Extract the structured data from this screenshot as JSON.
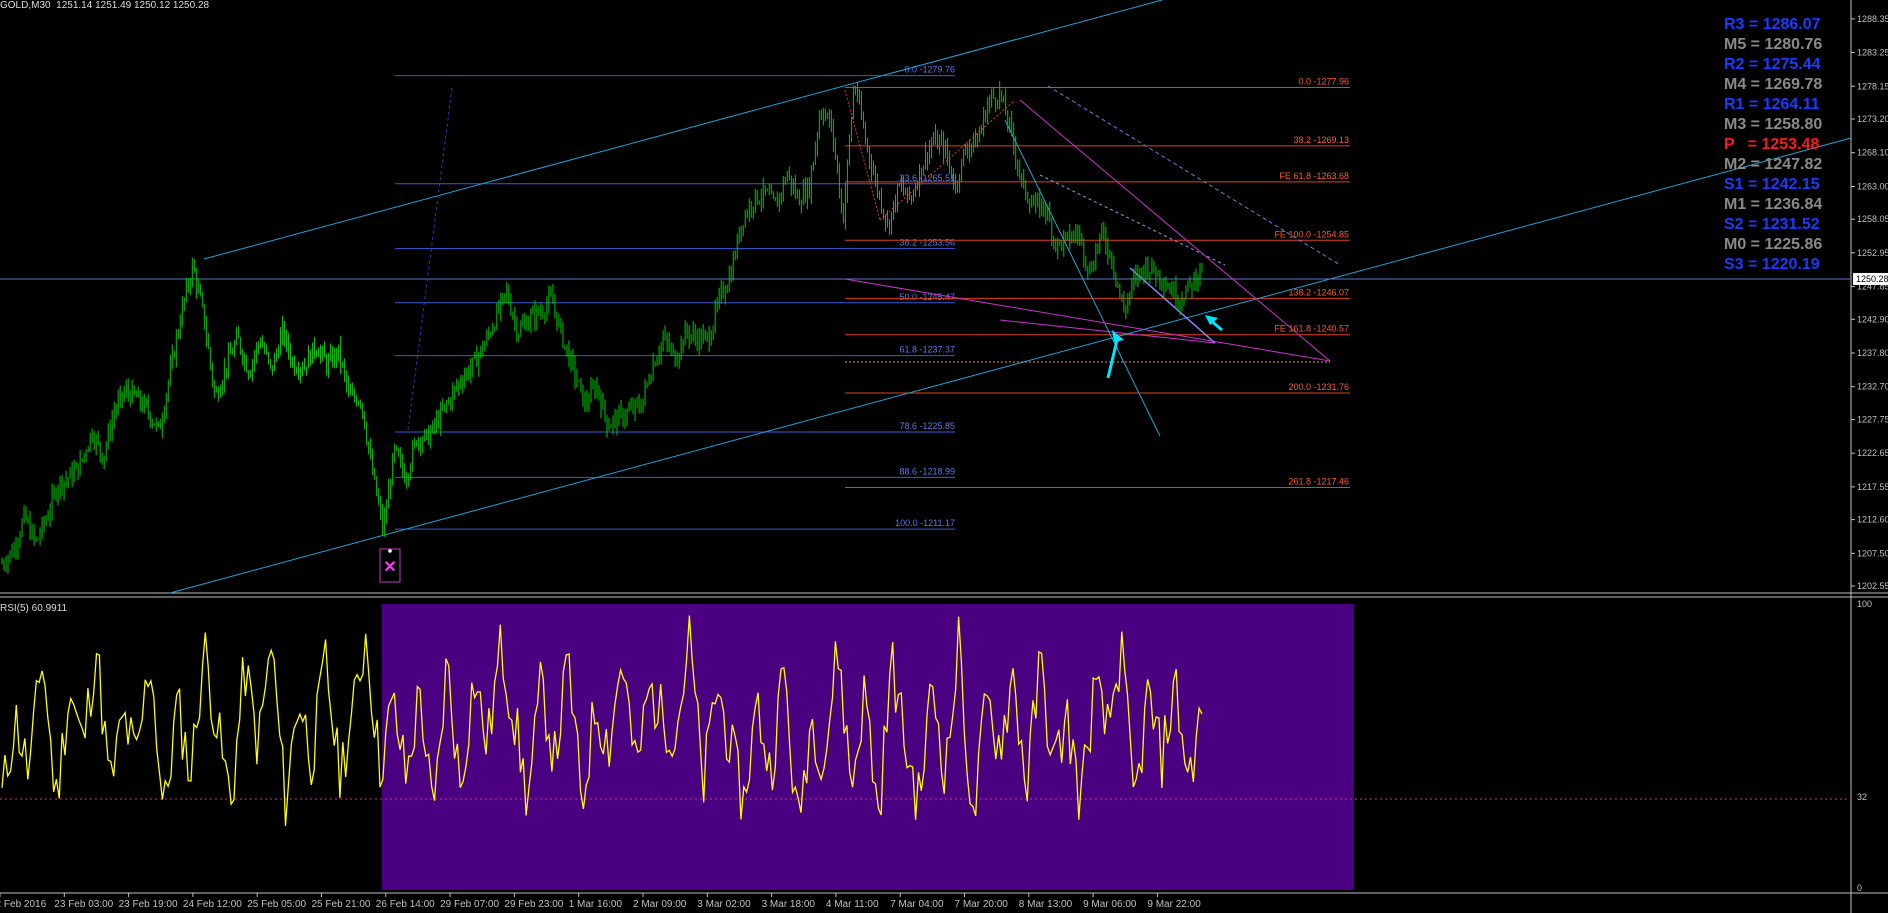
{
  "header": {
    "symbol": "GOLD,M30",
    "ohlc": "1251.14 1251.49 1250.12 1250.28",
    "current_price": "1250.28"
  },
  "rsi": {
    "label": "RSI(5) 60.9911",
    "levels": [
      "100",
      "32",
      "0"
    ]
  },
  "colors": {
    "background": "#000000",
    "candles": "#00c800",
    "channel": "#1fa5d8",
    "fib_retracement": "#3a5bd8",
    "fib_expansion": "#e0401a",
    "magenta": "#cc33cc",
    "rsi_line": "#ffff00",
    "rsi_zone": "#4b0082"
  },
  "pivots": [
    {
      "label": "R3 = 1286.07",
      "color": "#1a3cff"
    },
    {
      "label": "M5 = 1280.76",
      "color": "#8a8a8a"
    },
    {
      "label": "R2 = 1275.44",
      "color": "#1a3cff"
    },
    {
      "label": "M4 = 1269.78",
      "color": "#8a8a8a"
    },
    {
      "label": "R1 = 1264.11",
      "color": "#1a3cff"
    },
    {
      "label": "M3 = 1258.80",
      "color": "#8a8a8a"
    },
    {
      "label": "P   = 1253.48",
      "color": "#ff1a1a"
    },
    {
      "label": "M2 = 1247.82",
      "color": "#8a8a8a"
    },
    {
      "label": "S1 = 1242.15",
      "color": "#1a3cff"
    },
    {
      "label": "M1 = 1236.84",
      "color": "#8a8a8a"
    },
    {
      "label": "S2 = 1231.52",
      "color": "#1a3cff"
    },
    {
      "label": "M0 = 1225.86",
      "color": "#8a8a8a"
    },
    {
      "label": "S3 = 1220.19",
      "color": "#1a3cff"
    }
  ],
  "chart_data": {
    "type": "line",
    "title": "GOLD,M30",
    "ylim": [
      1201.5,
      1291.2
    ],
    "y_ticks": [
      "1288.35",
      "1283.25",
      "1278.15",
      "1273.20",
      "1268.10",
      "1263.00",
      "1258.05",
      "1252.95",
      "1247.85",
      "1242.90",
      "1237.80",
      "1232.70",
      "1227.75",
      "1222.65",
      "1217.55",
      "1212.60",
      "1207.50",
      "1202.55"
    ],
    "x_labels": [
      "22 Feb 2016",
      "23 Feb 03:00",
      "23 Feb 19:00",
      "24 Feb 12:00",
      "25 Feb 05:00",
      "25 Feb 21:00",
      "26 Feb 14:00",
      "29 Feb 07:00",
      "29 Feb 23:00",
      "1 Mar 16:00",
      "2 Mar 09:00",
      "3 Mar 02:00",
      "3 Mar 18:00",
      "4 Mar 11:00",
      "7 Mar 04:00",
      "7 Mar 20:00",
      "8 Mar 13:00",
      "9 Mar 06:00",
      "9 Mar 22:00"
    ],
    "close_path": [
      1206,
      1208,
      1213,
      1209,
      1213,
      1218,
      1219,
      1221,
      1226,
      1222,
      1229,
      1232,
      1231,
      1229,
      1226,
      1235,
      1244,
      1251,
      1243,
      1231,
      1236,
      1240,
      1235,
      1240,
      1235,
      1241,
      1236,
      1236,
      1239,
      1236,
      1238,
      1231,
      1231,
      1220,
      1211,
      1223,
      1219,
      1225,
      1225,
      1228,
      1231,
      1234,
      1236,
      1239,
      1243,
      1247,
      1241,
      1243,
      1244,
      1246,
      1240,
      1235,
      1230,
      1233,
      1227,
      1228,
      1229,
      1230,
      1236,
      1240,
      1237,
      1241,
      1240,
      1240,
      1246,
      1250,
      1258,
      1261,
      1262,
      1260,
      1265,
      1261,
      1263,
      1275,
      1272,
      1258,
      1279,
      1270,
      1263,
      1257,
      1263,
      1261,
      1266,
      1270,
      1269,
      1263,
      1269,
      1270,
      1276,
      1277,
      1271,
      1263,
      1260,
      1260,
      1254,
      1255,
      1256,
      1250,
      1256,
      1252,
      1244,
      1249,
      1251,
      1250,
      1248,
      1246,
      1248,
      1251
    ],
    "series": [
      {
        "name": "RSI(5)",
        "values": [
          32,
          60,
          40,
          82,
          30,
          70,
          50,
          85,
          35,
          60,
          45,
          82,
          25,
          65,
          40,
          85,
          55,
          30,
          78,
          50,
          86,
          30,
          68,
          45,
          80,
          40,
          60,
          90,
          42,
          65,
          38,
          70,
          22,
          80,
          35,
          75,
          50,
          85,
          60,
          30,
          72,
          45,
          80,
          28,
          65,
          50,
          82,
          40,
          70,
          60,
          55,
          88,
          35,
          72,
          50,
          30,
          65,
          40,
          78,
          20,
          60,
          45,
          85,
          35,
          70,
          25,
          80,
          50,
          30,
          72,
          40,
          88,
          20,
          66,
          50,
          75,
          35,
          80,
          42,
          60,
          30,
          70,
          55,
          84,
          28,
          68,
          45,
          72,
          38,
          62
        ]
      }
    ],
    "rsi_ylim": [
      0,
      100
    ],
    "rsi_level": 32,
    "fib_retracement": [
      {
        "label": "0.0 -1279.76",
        "price": 1279.76
      },
      {
        "label": "23.6 -1265.51",
        "price": 1263.4
      },
      {
        "label": "38.2 -1253.56",
        "price": 1253.6
      },
      {
        "label": "50.0 -1245.47",
        "price": 1245.4
      },
      {
        "label": "61.8 -1237.37",
        "price": 1237.4
      },
      {
        "label": "78.6 -1225.85",
        "price": 1225.85
      },
      {
        "label": "88.6 -1218.99",
        "price": 1218.99
      },
      {
        "label": "100.0 -1211.17",
        "price": 1211.17
      }
    ],
    "fib_expansion": [
      {
        "label": "0.0 -1277.96",
        "price": 1277.96
      },
      {
        "label": "38.2 -1269.13",
        "price": 1269.13
      },
      {
        "label": "FE 61.8 -1263.68",
        "price": 1263.68
      },
      {
        "label": "FE 100.0 -1254.85",
        "price": 1254.85
      },
      {
        "label": "138.2 -1246.07",
        "price": 1246.07
      },
      {
        "label": "FE 161.8 -1240.57",
        "price": 1240.57
      },
      {
        "label": "200.0 -1231.76",
        "price": 1231.76
      },
      {
        "label": "261.8 -1217.46",
        "price": 1217.46
      }
    ]
  }
}
